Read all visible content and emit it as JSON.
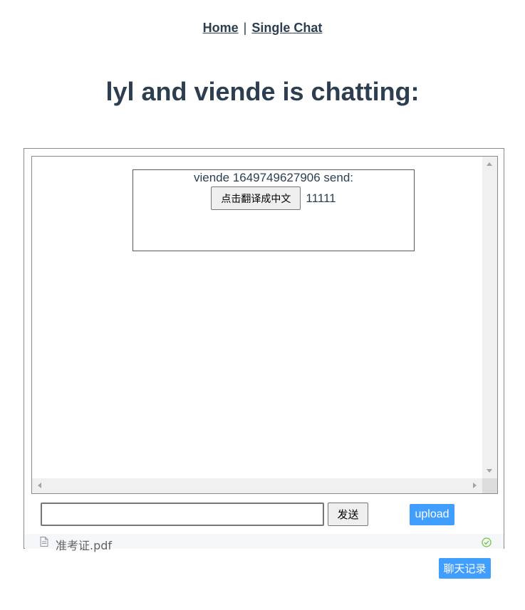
{
  "nav": {
    "home": "Home",
    "separator": "|",
    "single_chat": "Single Chat"
  },
  "page": {
    "title": "lyl and viende is chatting:"
  },
  "messages": [
    {
      "header": "viende 1649749627906 send:",
      "translate_label": "点击翻译成中文",
      "text": "11111"
    }
  ],
  "composer": {
    "input_value": "",
    "send_label": "发送",
    "upload_label": "upload"
  },
  "upload_list": [
    {
      "name": "准考证.pdf",
      "status": "success"
    }
  ],
  "history": {
    "label": "聊天记录"
  },
  "colors": {
    "text": "#2c3e50",
    "primary": "#409eff",
    "success": "#67c23a"
  }
}
